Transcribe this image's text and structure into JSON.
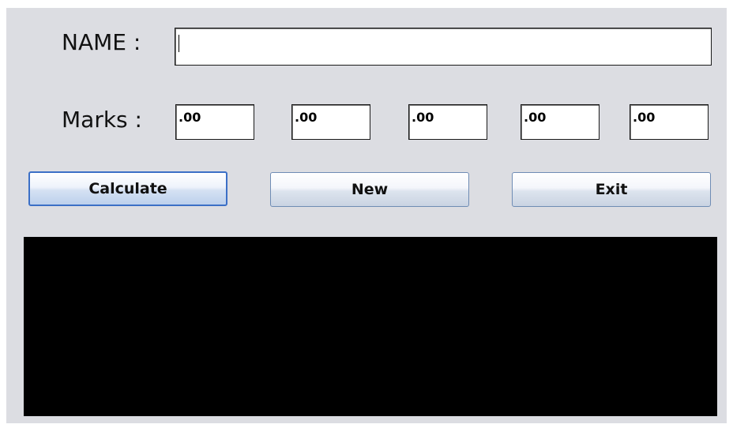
{
  "form": {
    "name_label": "NAME :",
    "name_value": "",
    "marks_label": "Marks :",
    "marks": [
      ".00",
      ".00",
      ".00",
      ".00",
      ".00"
    ]
  },
  "buttons": {
    "calculate_label": "Calculate",
    "new_label": "New",
    "exit_label": "Exit"
  },
  "output": {
    "text": "",
    "background_color": "#000000"
  },
  "colors": {
    "window_background": "#dcdde2",
    "focused_button_border": "#3b6fc6"
  }
}
